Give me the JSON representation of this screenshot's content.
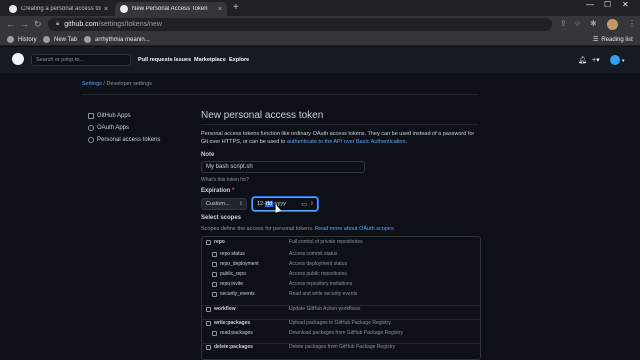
{
  "browser": {
    "tabs": [
      {
        "title": "Creating a personal access toke",
        "close": "×"
      },
      {
        "title": "New Personal Access Token",
        "close": "×"
      }
    ],
    "new_tab": "+",
    "url_host": "github.com",
    "url_path": "/settings/tokens/new",
    "bookmarks": [
      "History",
      "New Tab",
      "arrhythmia meanin..."
    ],
    "reading_list": "Reading list"
  },
  "header": {
    "search_placeholder": "Search or jump to...",
    "nav": [
      "Pull requests",
      "Issues",
      "Marketplace",
      "Explore"
    ]
  },
  "breadcrumb": {
    "settings": "Settings",
    "separator": "/",
    "current": "Developer settings"
  },
  "sidebar": {
    "items": [
      {
        "label": "GitHub Apps"
      },
      {
        "label": "OAuth Apps"
      },
      {
        "label": "Personal access tokens"
      }
    ]
  },
  "main": {
    "title": "New personal access token",
    "intro_text": "Personal access tokens function like ordinary OAuth access tokens. They can be used instead of a password for Git over HTTPS, or can be used to ",
    "intro_link": "authenticate to the API over Basic Authentication",
    "intro_end": ".",
    "note_label": "Note",
    "note_value": "My  bash script.sh",
    "note_hint": "What's this token for?",
    "expiration_label": "Expiration",
    "required_mark": "*",
    "expiration_select": "Custom...",
    "date_prefix": "12-",
    "date_selected": "dd",
    "date_suffix": "-yyyy",
    "scopes_label": "Select scopes",
    "scopes_desc": "Scopes define the access for personal tokens. ",
    "scopes_link": "Read more about OAuth scopes."
  },
  "scopes": [
    {
      "name": "repo",
      "desc": "Full control of private repositories",
      "top": true
    },
    {
      "name": "repo:status",
      "desc": "Access commit status",
      "top": false
    },
    {
      "name": "repo_deployment",
      "desc": "Access deployment status",
      "top": false
    },
    {
      "name": "public_repo",
      "desc": "Access public repositories",
      "top": false
    },
    {
      "name": "repo:invite",
      "desc": "Access repository invitations",
      "top": false
    },
    {
      "name": "security_events",
      "desc": "Read and write security events",
      "top": false
    },
    {
      "name": "workflow",
      "desc": "Update GitHub Action workflows",
      "top": true
    },
    {
      "name": "write:packages",
      "desc": "Upload packages to GitHub Package Registry",
      "top": true
    },
    {
      "name": "read:packages",
      "desc": "Download packages from GitHub Package Registry",
      "top": false
    },
    {
      "name": "delete:packages",
      "desc": "Delete packages from GitHub Package Registry",
      "top": true
    }
  ]
}
